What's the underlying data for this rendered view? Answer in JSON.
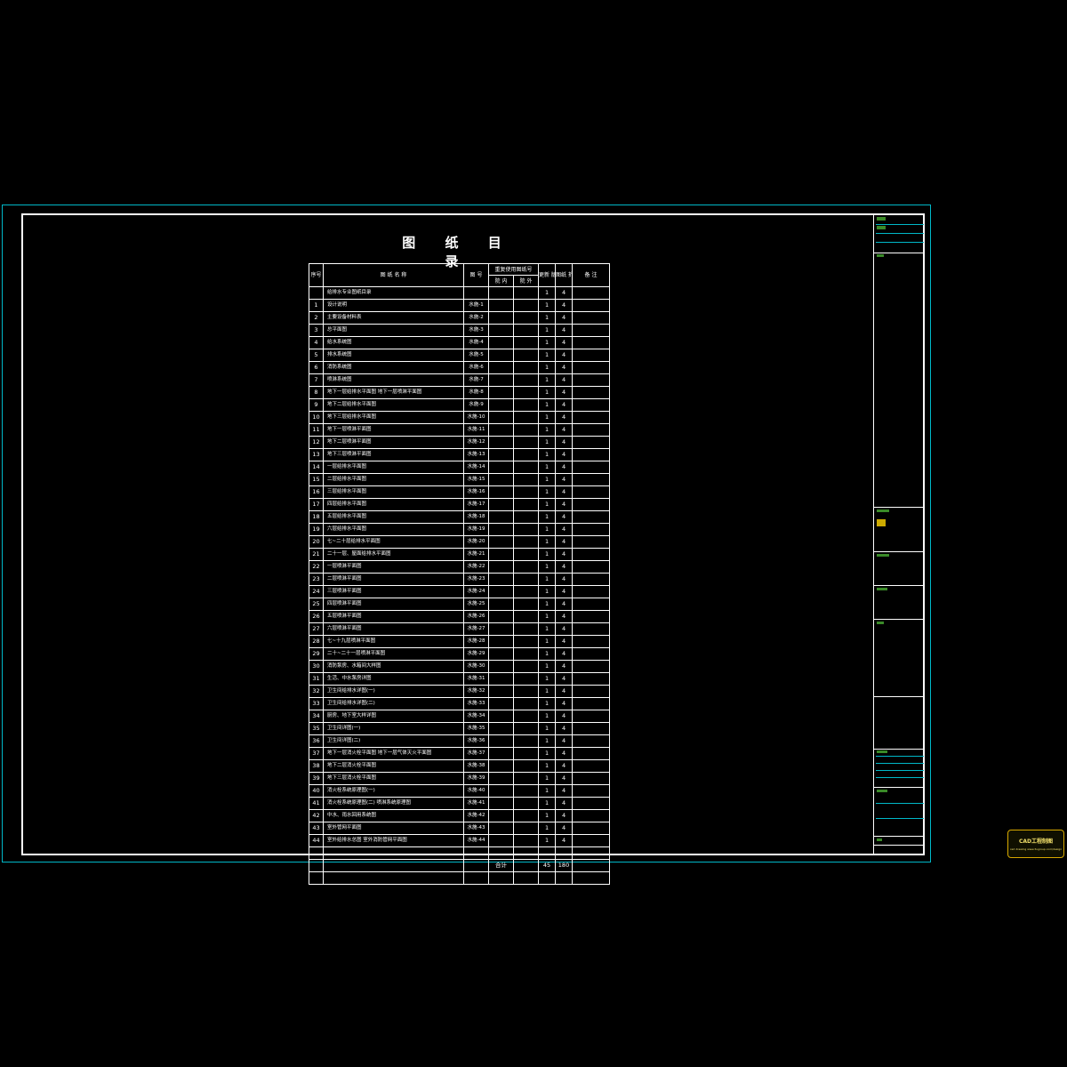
{
  "title": "图 纸 目 录",
  "headers": {
    "seq": "序号",
    "name": "图 纸 名 称",
    "drawing_no": "图 号",
    "reused_group": "重复使用图纸号",
    "reused_internal": "院 内",
    "reused_external": "院 外",
    "new_version": "更新 版次",
    "size": "图纸 折合A1",
    "remarks": "备 注"
  },
  "rows": [
    {
      "seq": "",
      "name": "给排水专业图纸目录",
      "no": "",
      "ver": "1",
      "size": "4"
    },
    {
      "seq": "1",
      "name": "设计说明",
      "no": "水施-1",
      "ver": "1",
      "size": "4"
    },
    {
      "seq": "2",
      "name": "主要设备材料表",
      "no": "水施-2",
      "ver": "1",
      "size": "4"
    },
    {
      "seq": "3",
      "name": "总平面图",
      "no": "水施-3",
      "ver": "1",
      "size": "4"
    },
    {
      "seq": "4",
      "name": "给水系统图",
      "no": "水施-4",
      "ver": "1",
      "size": "4"
    },
    {
      "seq": "5",
      "name": "排水系统图",
      "no": "水施-5",
      "ver": "1",
      "size": "4"
    },
    {
      "seq": "6",
      "name": "消防系统图",
      "no": "水施-6",
      "ver": "1",
      "size": "4"
    },
    {
      "seq": "7",
      "name": "喷淋系统图",
      "no": "水施-7",
      "ver": "1",
      "size": "4"
    },
    {
      "seq": "8",
      "name": "地下一层给排水平面图    地下一层喷淋平面图",
      "no": "水施-8",
      "ver": "1",
      "size": "4"
    },
    {
      "seq": "9",
      "name": "地下二层给排水平面图",
      "no": "水施-9",
      "ver": "1",
      "size": "4"
    },
    {
      "seq": "10",
      "name": "地下三层给排水平面图",
      "no": "水施-10",
      "ver": "1",
      "size": "4"
    },
    {
      "seq": "11",
      "name": "地下一层喷淋平面图",
      "no": "水施-11",
      "ver": "1",
      "size": "4"
    },
    {
      "seq": "12",
      "name": "地下二层喷淋平面图",
      "no": "水施-12",
      "ver": "1",
      "size": "4"
    },
    {
      "seq": "13",
      "name": "地下三层喷淋平面图",
      "no": "水施-13",
      "ver": "1",
      "size": "4"
    },
    {
      "seq": "14",
      "name": "一层给排水平面图",
      "no": "水施-14",
      "ver": "1",
      "size": "4"
    },
    {
      "seq": "15",
      "name": "二层给排水平面图",
      "no": "水施-15",
      "ver": "1",
      "size": "4"
    },
    {
      "seq": "16",
      "name": "三层给排水平面图",
      "no": "水施-16",
      "ver": "1",
      "size": "4"
    },
    {
      "seq": "17",
      "name": "四层给排水平面图",
      "no": "水施-17",
      "ver": "1",
      "size": "4"
    },
    {
      "seq": "18",
      "name": "五层给排水平面图",
      "no": "水施-18",
      "ver": "1",
      "size": "4"
    },
    {
      "seq": "19",
      "name": "六层给排水平面图",
      "no": "水施-19",
      "ver": "1",
      "size": "4"
    },
    {
      "seq": "20",
      "name": "七~二十层给排水平面图",
      "no": "水施-20",
      "ver": "1",
      "size": "4"
    },
    {
      "seq": "21",
      "name": "二十一层、屋面给排水平面图",
      "no": "水施-21",
      "ver": "1",
      "size": "4"
    },
    {
      "seq": "22",
      "name": "一层喷淋平面图",
      "no": "水施-22",
      "ver": "1",
      "size": "4"
    },
    {
      "seq": "23",
      "name": "二层喷淋平面图",
      "no": "水施-23",
      "ver": "1",
      "size": "4"
    },
    {
      "seq": "24",
      "name": "三层喷淋平面图",
      "no": "水施-24",
      "ver": "1",
      "size": "4"
    },
    {
      "seq": "25",
      "name": "四层喷淋平面图",
      "no": "水施-25",
      "ver": "1",
      "size": "4"
    },
    {
      "seq": "26",
      "name": "五层喷淋平面图",
      "no": "水施-26",
      "ver": "1",
      "size": "4"
    },
    {
      "seq": "27",
      "name": "六层喷淋平面图",
      "no": "水施-27",
      "ver": "1",
      "size": "4"
    },
    {
      "seq": "28",
      "name": "七~十九层喷淋平面图",
      "no": "水施-28",
      "ver": "1",
      "size": "4"
    },
    {
      "seq": "29",
      "name": "二十~二十一层喷淋平面图",
      "no": "水施-29",
      "ver": "1",
      "size": "4"
    },
    {
      "seq": "30",
      "name": "消防泵房、水箱间大样图",
      "no": "水施-30",
      "ver": "1",
      "size": "4"
    },
    {
      "seq": "31",
      "name": "生活、中水泵房详图",
      "no": "水施-31",
      "ver": "1",
      "size": "4"
    },
    {
      "seq": "32",
      "name": "卫生间给排水详图(一)",
      "no": "水施-32",
      "ver": "1",
      "size": "4"
    },
    {
      "seq": "33",
      "name": "卫生间给排水详图(二)",
      "no": "水施-33",
      "ver": "1",
      "size": "4"
    },
    {
      "seq": "34",
      "name": "厨房、地下室大样详图",
      "no": "水施-34",
      "ver": "1",
      "size": "4"
    },
    {
      "seq": "35",
      "name": "卫生间详图(一)",
      "no": "水施-35",
      "ver": "1",
      "size": "4"
    },
    {
      "seq": "36",
      "name": "卫生间详图(二)",
      "no": "水施-36",
      "ver": "1",
      "size": "4"
    },
    {
      "seq": "37",
      "name": "地下一层消火栓平面图    地下一层气体灭火平面图",
      "no": "水施-37",
      "ver": "1",
      "size": "4"
    },
    {
      "seq": "38",
      "name": "地下二层消火栓平面图",
      "no": "水施-38",
      "ver": "1",
      "size": "4"
    },
    {
      "seq": "39",
      "name": "地下三层消火栓平面图",
      "no": "水施-39",
      "ver": "1",
      "size": "4"
    },
    {
      "seq": "40",
      "name": "消火栓系统原理图(一)",
      "no": "水施-40",
      "ver": "1",
      "size": "4"
    },
    {
      "seq": "41",
      "name": "消火栓系统原理图(二)  喷淋系统原理图",
      "no": "水施-41",
      "ver": "1",
      "size": "4"
    },
    {
      "seq": "42",
      "name": "中水、雨水回用系统图",
      "no": "水施-42",
      "ver": "1",
      "size": "4"
    },
    {
      "seq": "43",
      "name": "室外管网平面图",
      "no": "水施-43",
      "ver": "1",
      "size": "4"
    },
    {
      "seq": "44",
      "name": "室外给排水总图    室外消防管网平面图",
      "no": "水施-44",
      "ver": "1",
      "size": "4"
    }
  ],
  "totals": {
    "label": "合计",
    "ver": "45",
    "size": "180"
  },
  "stamp": {
    "line1": "CAD工程制图",
    "line2": "cad drawing www.3ugroup.com/design"
  }
}
